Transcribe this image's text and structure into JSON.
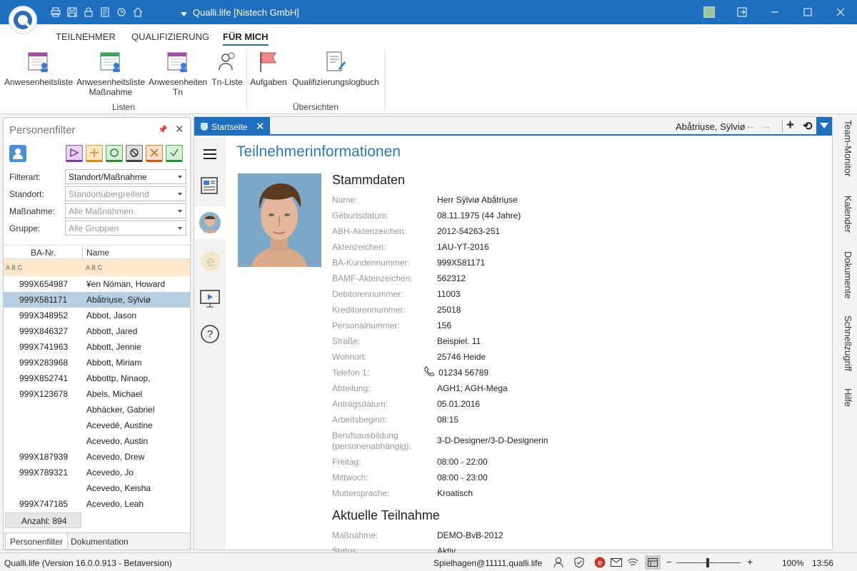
{
  "window": {
    "title": "Qualli.life [Nistech GmbH]",
    "quick_access_icons": [
      "print-icon",
      "save-icon",
      "lock-icon",
      "receipt-icon",
      "refresh-icon",
      "home-icon",
      "dropdown-icon"
    ],
    "controls": [
      "theme-icon",
      "restore-icon",
      "minimize-icon",
      "maximize-icon",
      "close-icon"
    ]
  },
  "ribbon": {
    "tabs": [
      {
        "label": "TEILNEHMER"
      },
      {
        "label": "QUALIFIZIERUNG"
      },
      {
        "label": "FÜR MICH",
        "active": true
      }
    ],
    "buttons": [
      {
        "label": "Anwesenheitsliste"
      },
      {
        "label1": "Anwesenheitsliste",
        "label2": "Maßnahme"
      },
      {
        "label1": "Anwesenheiten",
        "label2": "Tn"
      },
      {
        "label": "Tn-Liste"
      },
      {
        "label": "Aufgaben"
      },
      {
        "label": "Qualifizierungslogbuch"
      }
    ],
    "groups": [
      "Listen",
      "Übersichten"
    ]
  },
  "personenfilter": {
    "title": "Personenfilter",
    "filters": [
      {
        "label": "Filterart:",
        "value": "Standort/Maßnahme",
        "placeholder": false
      },
      {
        "label": "Standort:",
        "value": "Standortübergreifend",
        "placeholder": true
      },
      {
        "label": "Maßnahme:",
        "value": "Alle Maßnahmen",
        "placeholder": true
      },
      {
        "label": "Gruppe:",
        "value": "Alle Gruppen",
        "placeholder": true
      }
    ],
    "columns": [
      "BA-Nr.",
      "Name"
    ],
    "filter_row_icons": [
      "abc-filter-icon",
      "abc-filter-icon"
    ],
    "rows": [
      {
        "ba": "999X654987",
        "name": "¥en Nöman, Howard"
      },
      {
        "ba": "999X581171",
        "name": "Abắtriụse, Sÿlviø",
        "selected": true
      },
      {
        "ba": "999X348952",
        "name": "Abbot, Jason"
      },
      {
        "ba": "999X846327",
        "name": "Abbott, Jared"
      },
      {
        "ba": "999X741963",
        "name": "Abbott, Jennie"
      },
      {
        "ba": "999X283968",
        "name": "Abbott, Miriam"
      },
      {
        "ba": "999X852741",
        "name": "Abbottp, Ninaop,"
      },
      {
        "ba": "999X123678",
        "name": "Abels, Michael"
      },
      {
        "ba": "",
        "name": "Abhäcker, Gabriel"
      },
      {
        "ba": "",
        "name": "Acevedē, Austine"
      },
      {
        "ba": "",
        "name": "Acevedo, Austin"
      },
      {
        "ba": "999X187939",
        "name": "Acevedo, Drew"
      },
      {
        "ba": "999X789321",
        "name": "Acevedo, Jo"
      },
      {
        "ba": "",
        "name": "Acevedo, Keisha"
      },
      {
        "ba": "999X747185",
        "name": "Acevedo, Leah"
      }
    ],
    "count": "Anzahl: 894",
    "bottom_tabs": [
      "Personenfilter",
      "Dokumentation"
    ]
  },
  "document": {
    "tab_label": "Startseite",
    "current_person": "Abắtriụse, Sÿlviø",
    "page_title": "Teilnehmerinformationen",
    "stammdaten": {
      "title": "Stammdaten",
      "fields": [
        {
          "label": "Name:",
          "value": "Herr Sÿlviø Abắtriụse"
        },
        {
          "label": "Geburtsdatum:",
          "value": "08.11.1975 (44 Jahre)"
        },
        {
          "label": "ABH-Aktenzeichen:",
          "value": "2012-54263-251"
        },
        {
          "label": "Aktenzeichen:",
          "value": "1AU-YT-2016"
        },
        {
          "label": "BA-Kundennummer:",
          "value": "999X581171"
        },
        {
          "label": "BAMF-Aktenzeichen:",
          "value": "562312"
        },
        {
          "label": "Debitorennummer:",
          "value": "11003"
        },
        {
          "label": "Kreditorennummer:",
          "value": "25018"
        },
        {
          "label": "Personalnummer:",
          "value": "156"
        },
        {
          "label": "Straße:",
          "value": "Beispiel. 11"
        },
        {
          "label": "Wohnort:",
          "value": "25746 Heide"
        },
        {
          "label": "Telefon 1:",
          "value": "01234 56789",
          "icon": "phone-icon"
        },
        {
          "label": "Abteilung:",
          "value": "AGH1; AGH-Mega"
        },
        {
          "label": "Antragsdatum:",
          "value": "05.01.2016"
        },
        {
          "label": "Arbeitsbeginn:",
          "value": "08:15"
        },
        {
          "label1": "Berufsausbildung",
          "label2": "(personenabhängig):",
          "value": "3-D-Designer/3-D-Designerin"
        },
        {
          "label": "Freitag:",
          "value": "08:00 - 22:00"
        },
        {
          "label": "Mittwoch:",
          "value": "08:00 - 23:00"
        },
        {
          "label": "Muttersprache:",
          "value": "Kroatisch"
        }
      ]
    },
    "teilnahme": {
      "title": "Aktuelle Teilnahme",
      "fields": [
        {
          "label": "Maßnahme:",
          "value": "DEMO-BvB-2012"
        },
        {
          "label": "Status:",
          "value": "Aktiv"
        }
      ]
    }
  },
  "right_tabs": [
    "Team-Monitor",
    "Kalender",
    "Dokumente",
    "Schnellzugriff",
    "Hilfe"
  ],
  "statusbar": {
    "version": "Qualli.life (Version 16.0.0.913 - Betaversion)",
    "user": "Spielhagen@11111.qualli.life",
    "zoom": "100%",
    "time": "13:56"
  },
  "colors": {
    "accent": "#1f6fbf",
    "selection": "#b7cfe0",
    "filter_row": "#fde8cc",
    "title_blue": "#2a78c2"
  }
}
